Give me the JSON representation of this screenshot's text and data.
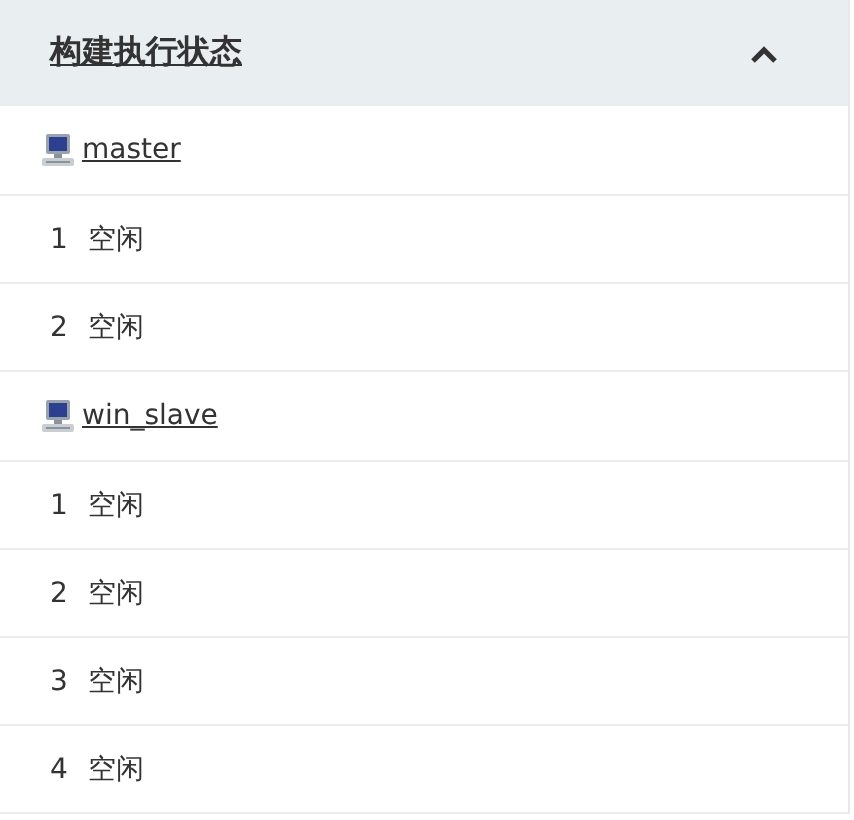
{
  "panel": {
    "title": "构建执行状态",
    "expanded": true,
    "nodes": [
      {
        "name": "master",
        "executors": [
          {
            "number": "1",
            "status": "空闲"
          },
          {
            "number": "2",
            "status": "空闲"
          }
        ]
      },
      {
        "name": "win_slave",
        "executors": [
          {
            "number": "1",
            "status": "空闲"
          },
          {
            "number": "2",
            "status": "空闲"
          },
          {
            "number": "3",
            "status": "空闲"
          },
          {
            "number": "4",
            "status": "空闲"
          }
        ]
      }
    ]
  }
}
